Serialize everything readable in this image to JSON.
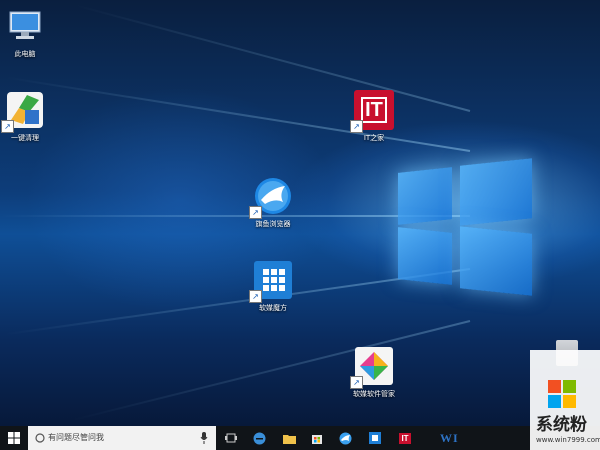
{
  "desktop": {
    "icons": [
      {
        "label": "此电脑",
        "icon": "computer-icon"
      },
      {
        "label": "一键清理",
        "icon": "cleanup-brush-icon"
      },
      {
        "label": "IT之家",
        "icon": "ithome-icon",
        "logo_text": "IT",
        "color": "#c8102e"
      },
      {
        "label": "旗鱼浏览器",
        "icon": "swordfish-browser-icon"
      },
      {
        "label": "软媒魔方",
        "icon": "ruanmei-cube-icon"
      },
      {
        "label": "软媒软件管家",
        "icon": "software-manager-icon"
      }
    ]
  },
  "taskbar": {
    "start_icon": "windows-logo-icon",
    "search_placeholder": "有问题尽管问我",
    "pinned": [
      {
        "icon": "task-view-icon"
      },
      {
        "icon": "edge-icon",
        "color": "#3a8fd8"
      },
      {
        "icon": "file-explorer-icon",
        "color": "#f0c24b"
      },
      {
        "icon": "store-icon"
      },
      {
        "icon": "swordfish-browser-icon"
      },
      {
        "icon": "ruanmei-cube-icon"
      },
      {
        "icon": "ithome-icon",
        "text": "IT",
        "color": "#c8102e"
      }
    ],
    "partial_text": "WI"
  },
  "watermark": {
    "brand": "系统粉",
    "url": "www.win7999.com"
  }
}
